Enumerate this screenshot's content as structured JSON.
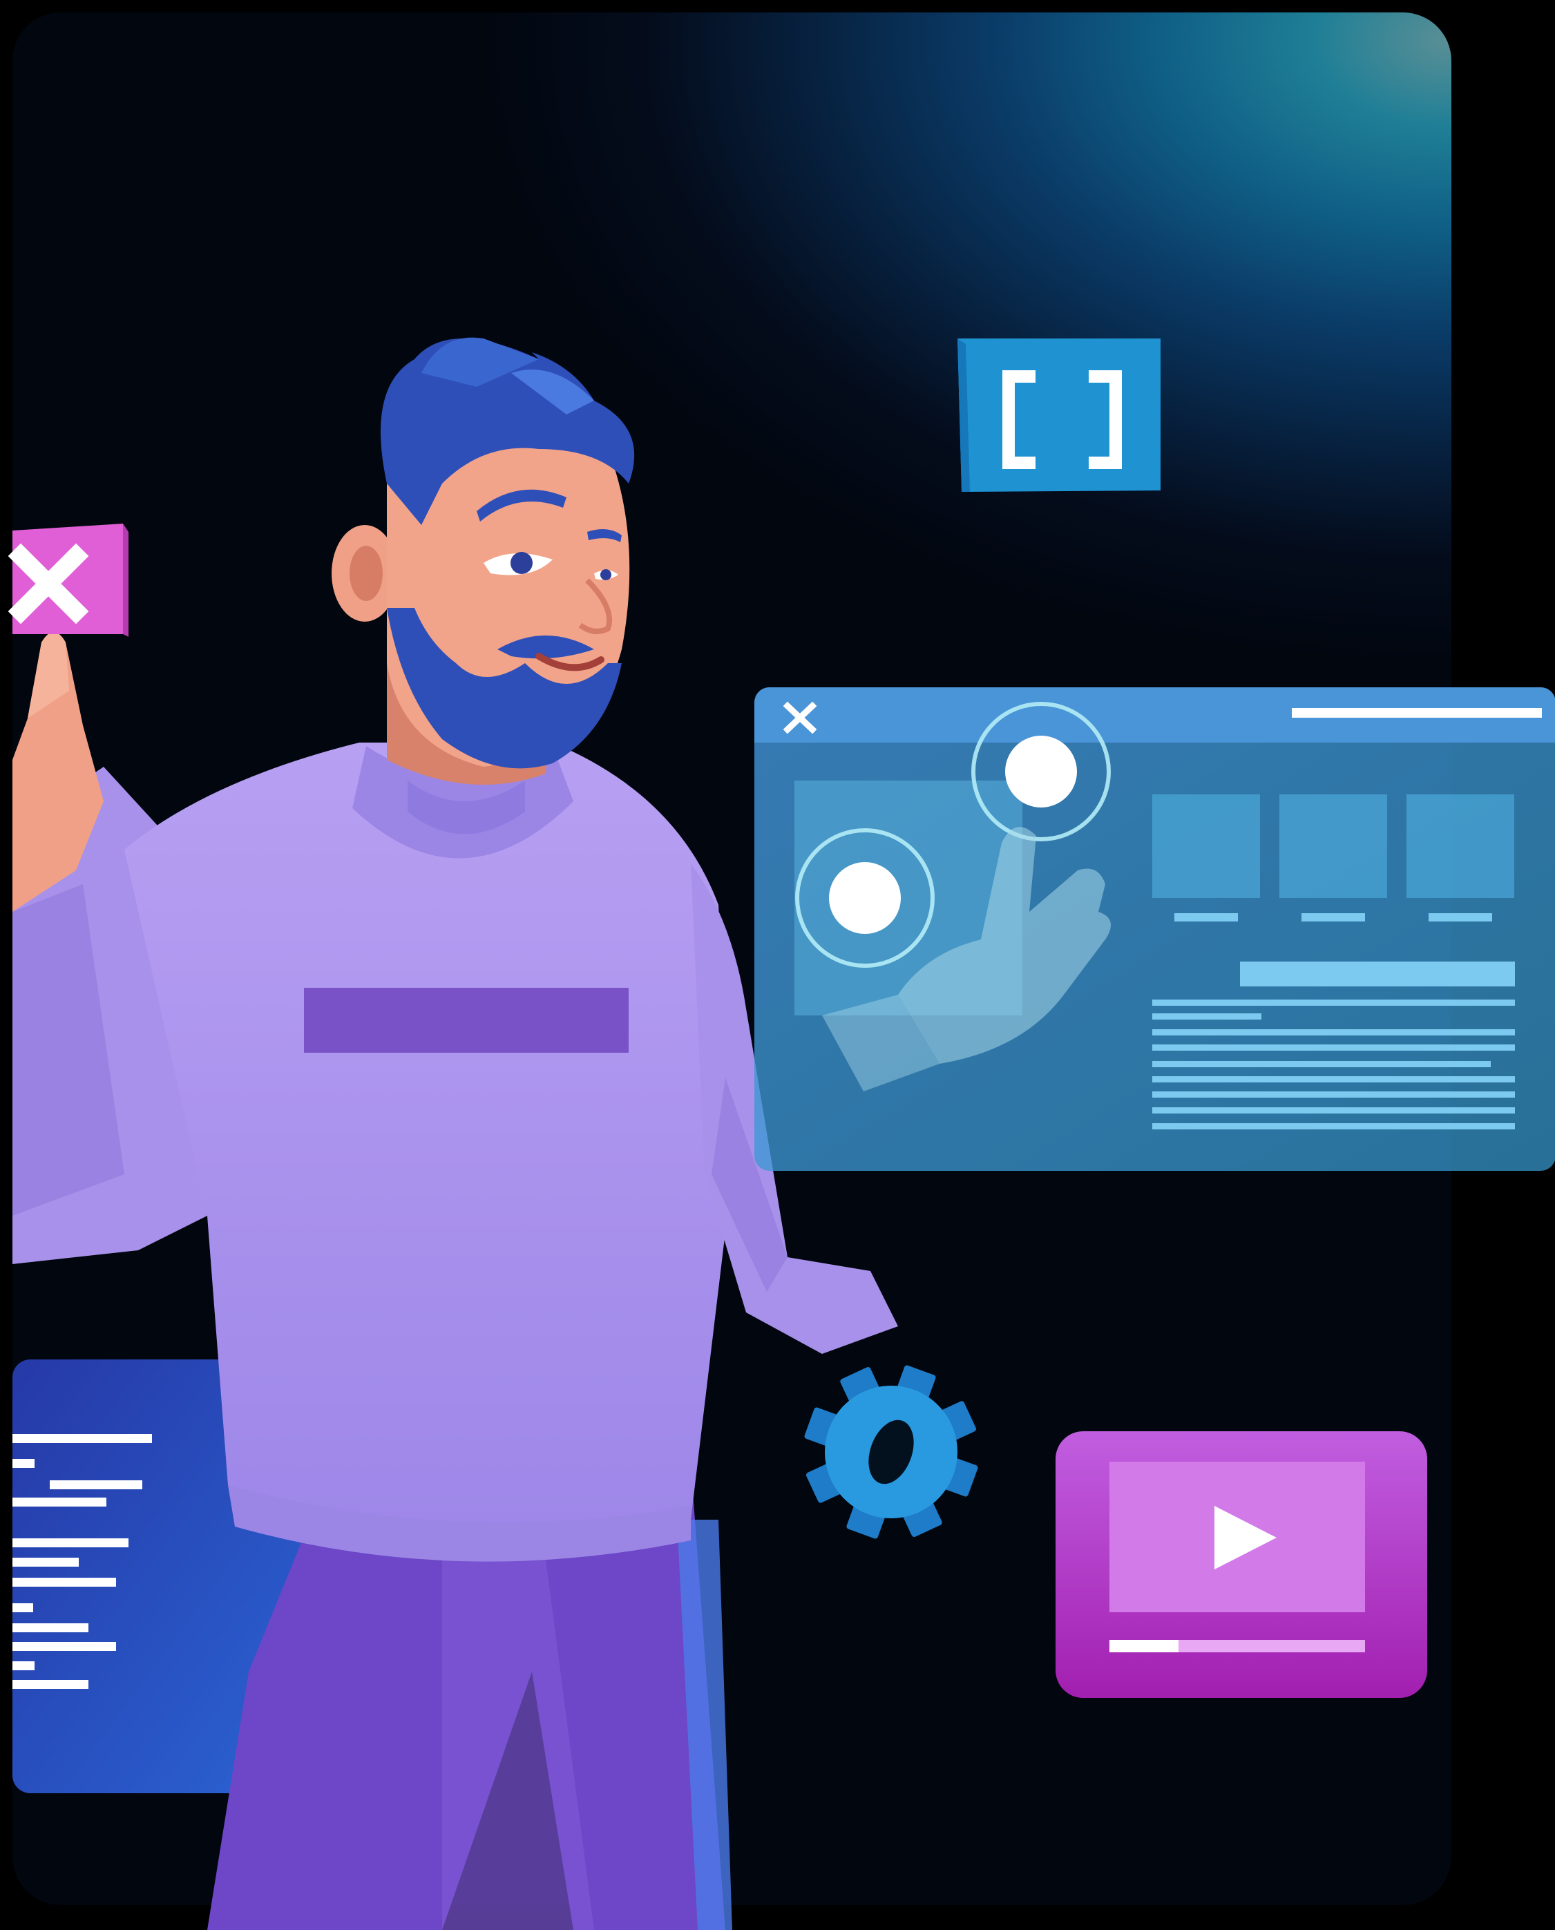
{
  "scene": {
    "accent_colors": {
      "background_dark": "#02060f",
      "background_teal": "#1f7f96",
      "sweater": "#b49af0",
      "hair_beard": "#2f4fb8",
      "panel_blue": "#3a8fd4",
      "magenta": "#c24fd8",
      "close_pink": "#e05fd6",
      "code_panel": "#2c55d6",
      "gear_blue": "#2a9ae0"
    },
    "icons": {
      "close_tile": "close-icon",
      "brackets_tile": "brackets-icon",
      "panel_close": "close-icon",
      "gear": "gear-icon",
      "video": "play-icon"
    },
    "video_player": {
      "progress_fraction": 0.27
    }
  }
}
